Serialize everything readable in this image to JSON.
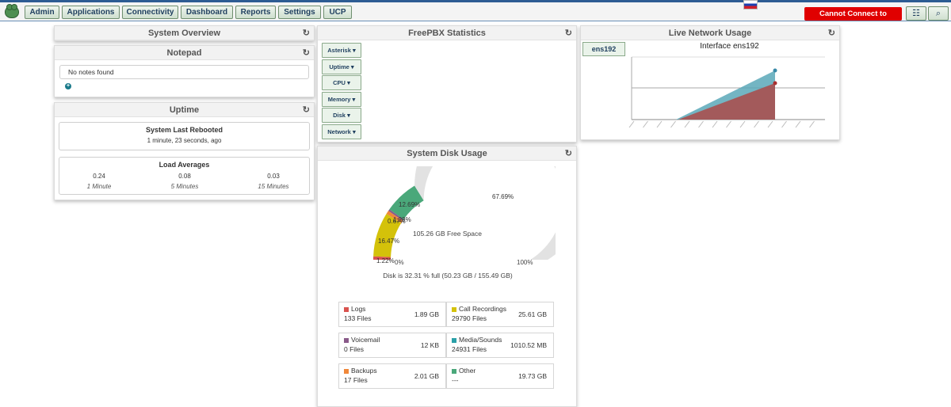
{
  "nav": {
    "items": [
      "Admin",
      "Applications",
      "Connectivity",
      "Dashboard",
      "Reports",
      "Settings",
      "UCP"
    ],
    "alert": "Cannot Connect to Asterisk"
  },
  "system_overview": {
    "title": "System Overview"
  },
  "notepad": {
    "title": "Notepad",
    "empty_text": "No notes found",
    "add_icon": "plus-circle-icon"
  },
  "uptime": {
    "title": "Uptime",
    "reboot_title": "System Last Rebooted",
    "reboot_value": "1 minute, 23 seconds, ago",
    "load_title": "Load Averages",
    "loads": [
      {
        "value": "0.24",
        "label": "1 Minute"
      },
      {
        "value": "0.08",
        "label": "5 Minutes"
      },
      {
        "value": "0.03",
        "label": "15 Minutes"
      }
    ]
  },
  "freepbx": {
    "title": "FreePBX Statistics",
    "tabs": [
      "Asterisk",
      "Uptime",
      "CPU",
      "Memory",
      "Disk",
      "Network"
    ]
  },
  "network": {
    "title": "Live Network Usage",
    "interface_tab": "ens192",
    "chart_title": "Interface ens192",
    "chart_data": {
      "type": "area",
      "title": "Interface ens192",
      "series": [
        {
          "color": "#5aa8b8"
        },
        {
          "color": "#a85050"
        }
      ]
    }
  },
  "disk": {
    "title": "System Disk Usage",
    "free_label": "105.26 GB Free Space",
    "min_label": "0%",
    "max_label": "100%",
    "summary": "Disk is 32.31 % full (50.23 GB / 155.49 GB)",
    "gauge_labels": [
      "1.22%",
      "16.47%",
      "0.67%",
      "1.29%",
      "12.69%",
      "67.69%"
    ],
    "chart_data": {
      "type": "pie",
      "slices": [
        {
          "label": "Logs",
          "value": 1.22,
          "color": "#d9534f"
        },
        {
          "label": "Call Recordings",
          "value": 16.47,
          "color": "#d4c20a"
        },
        {
          "label": "Backups",
          "value": 1.29,
          "color": "#f0883a"
        },
        {
          "label": "Voicemail",
          "value": 0.67,
          "color": "#8a5a8a"
        },
        {
          "label": "Other",
          "value": 12.69,
          "color": "#4aa87a"
        },
        {
          "label": "Free",
          "value": 67.69,
          "color": "#e2e2e2"
        }
      ]
    },
    "legend": [
      {
        "name": "Logs",
        "files": "133 Files",
        "size": "1.89 GB",
        "color": "#d9534f"
      },
      {
        "name": "Call Recordings",
        "files": "29790 Files",
        "size": "25.61 GB",
        "color": "#d4c20a"
      },
      {
        "name": "Voicemail",
        "files": "0 Files",
        "size": "12 KB",
        "color": "#8a5a8a"
      },
      {
        "name": "Media/Sounds",
        "files": "24931 Files",
        "size": "1010.52 MB",
        "color": "#2aa0a8"
      },
      {
        "name": "Backups",
        "files": "17 Files",
        "size": "2.01 GB",
        "color": "#f0883a"
      },
      {
        "name": "Other",
        "files": "---",
        "size": "19.73 GB",
        "color": "#4aa87a"
      }
    ]
  }
}
